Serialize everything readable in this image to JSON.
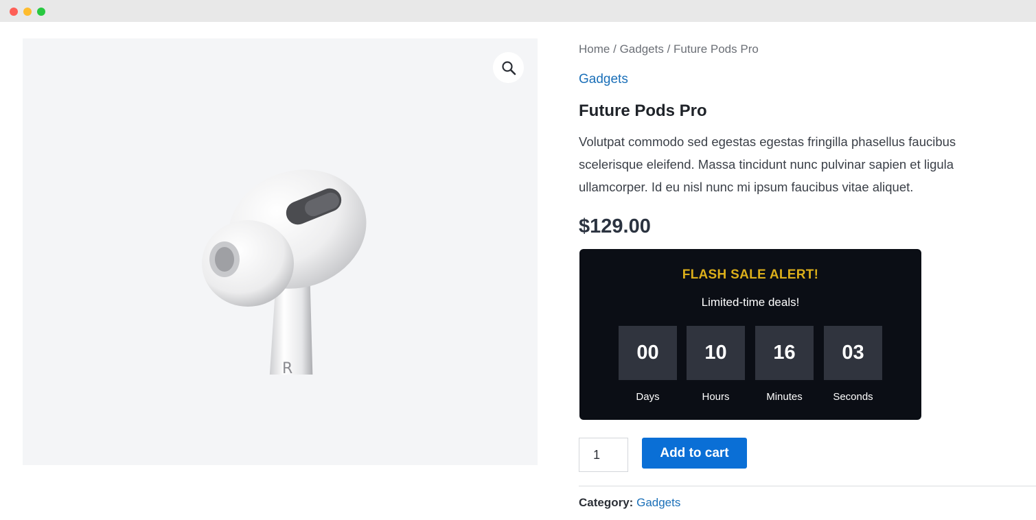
{
  "colors": {
    "accent": "#0a6fd6",
    "link": "#1a6fb8",
    "flash_bg": "#0b0e15",
    "flash_title": "#dcaf1a",
    "countdown_box": "#30343e"
  },
  "gallery": {
    "zoom_icon": "magnifier-icon",
    "image_alt": "Future Pods Pro earbud"
  },
  "breadcrumb": {
    "items": [
      "Home",
      "Gadgets",
      "Future Pods Pro"
    ],
    "separator": "/"
  },
  "product": {
    "category_link": "Gadgets",
    "title": "Future Pods Pro",
    "description": "Volutpat commodo sed egestas egestas fringilla phasellus faucibus scelerisque eleifend. Massa tincidunt nunc pulvinar sapien et ligula ullamcorper. Id eu nisl nunc mi ipsum faucibus vitae aliquet.",
    "price": "$129.00"
  },
  "flash_sale": {
    "title": "FLASH SALE ALERT!",
    "subtitle": "Limited-time deals!",
    "countdown": [
      {
        "value": "00",
        "label": "Days"
      },
      {
        "value": "10",
        "label": "Hours"
      },
      {
        "value": "16",
        "label": "Minutes"
      },
      {
        "value": "03",
        "label": "Seconds"
      }
    ]
  },
  "cart": {
    "quantity": "1",
    "add_label": "Add to cart"
  },
  "meta": {
    "category_label": "Category:",
    "category_value": "Gadgets"
  }
}
